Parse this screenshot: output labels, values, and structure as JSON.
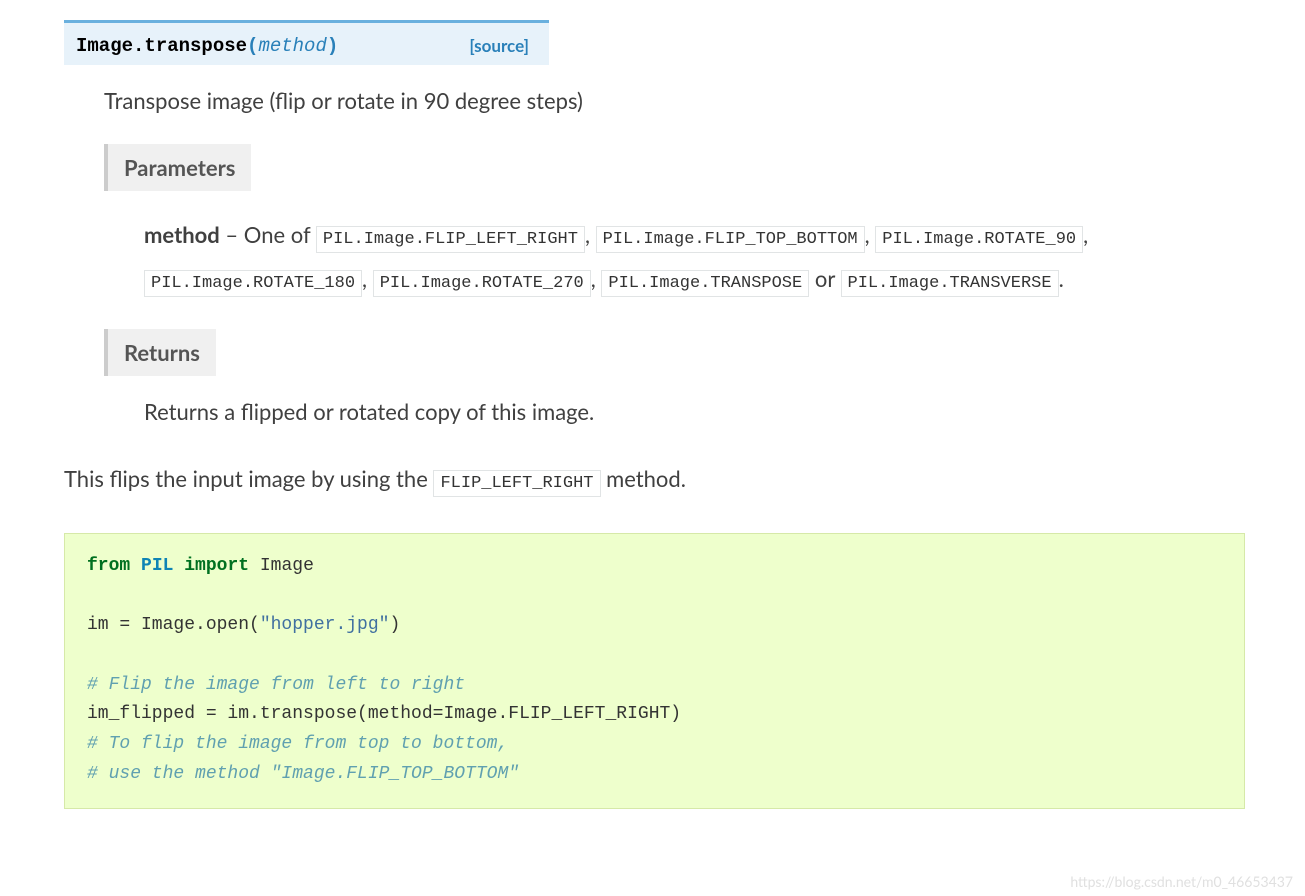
{
  "signature": {
    "class_method": "Image.transpose",
    "lparen": "(",
    "param": "method",
    "rparen": ")",
    "source_label": "[source]"
  },
  "description": "Transpose image (flip or rotate in 90 degree steps)",
  "params": {
    "header": "Parameters",
    "name": "method",
    "prefix": " – One of ",
    "constants": [
      "PIL.Image.FLIP_LEFT_RIGHT",
      "PIL.Image.FLIP_TOP_BOTTOM",
      "PIL.Image.ROTATE_90",
      "PIL.Image.ROTATE_180",
      "PIL.Image.ROTATE_270",
      "PIL.Image.TRANSPOSE",
      "PIL.Image.TRANSVERSE"
    ],
    "sep": ", ",
    "or": " or ",
    "end": "."
  },
  "returns": {
    "header": "Returns",
    "body": "Returns a flipped or rotated copy of this image."
  },
  "explain": {
    "pre": "This flips the input image by using the ",
    "code": "FLIP_LEFT_RIGHT",
    "post": " method."
  },
  "code": {
    "l1_from": "from",
    "l1_pil": "PIL",
    "l1_import": "import",
    "l1_image": "Image",
    "l3": "im = Image.open(",
    "l3_str": "\"hopper.jpg\"",
    "l3_end": ")",
    "l5_cmt": "# Flip the image from left to right",
    "l6": "im_flipped = im.transpose(method=Image.FLIP_LEFT_RIGHT)",
    "l7_cmt": "# To flip the image from top to bottom,",
    "l8_cmt": "# use the method \"Image.FLIP_TOP_BOTTOM\""
  },
  "watermark": "https://blog.csdn.net/m0_46653437"
}
